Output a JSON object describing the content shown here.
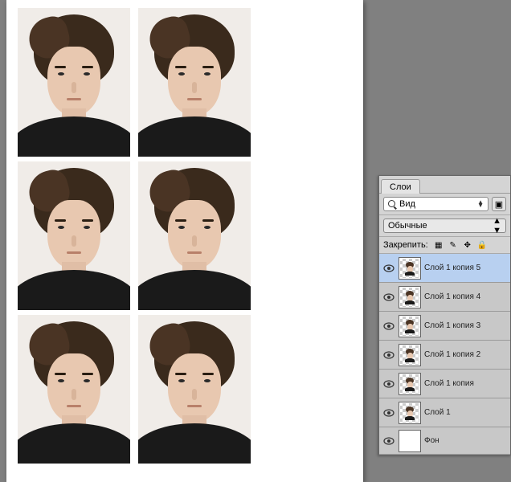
{
  "panel": {
    "tab_label": "Слои",
    "filter_label": "Вид",
    "blend_mode": "Обычные",
    "lock_label": "Закрепить:"
  },
  "layers": [
    {
      "name": "Слой 1 копия 5",
      "selected": true,
      "checker": true,
      "portrait": true
    },
    {
      "name": "Слой 1 копия 4",
      "selected": false,
      "checker": true,
      "portrait": true
    },
    {
      "name": "Слой 1 копия 3",
      "selected": false,
      "checker": true,
      "portrait": true
    },
    {
      "name": "Слой 1 копия 2",
      "selected": false,
      "checker": true,
      "portrait": true
    },
    {
      "name": "Слой 1 копия",
      "selected": false,
      "checker": true,
      "portrait": true
    },
    {
      "name": "Слой 1",
      "selected": false,
      "checker": true,
      "portrait": true
    },
    {
      "name": "Фон",
      "selected": false,
      "checker": false,
      "portrait": false
    }
  ]
}
